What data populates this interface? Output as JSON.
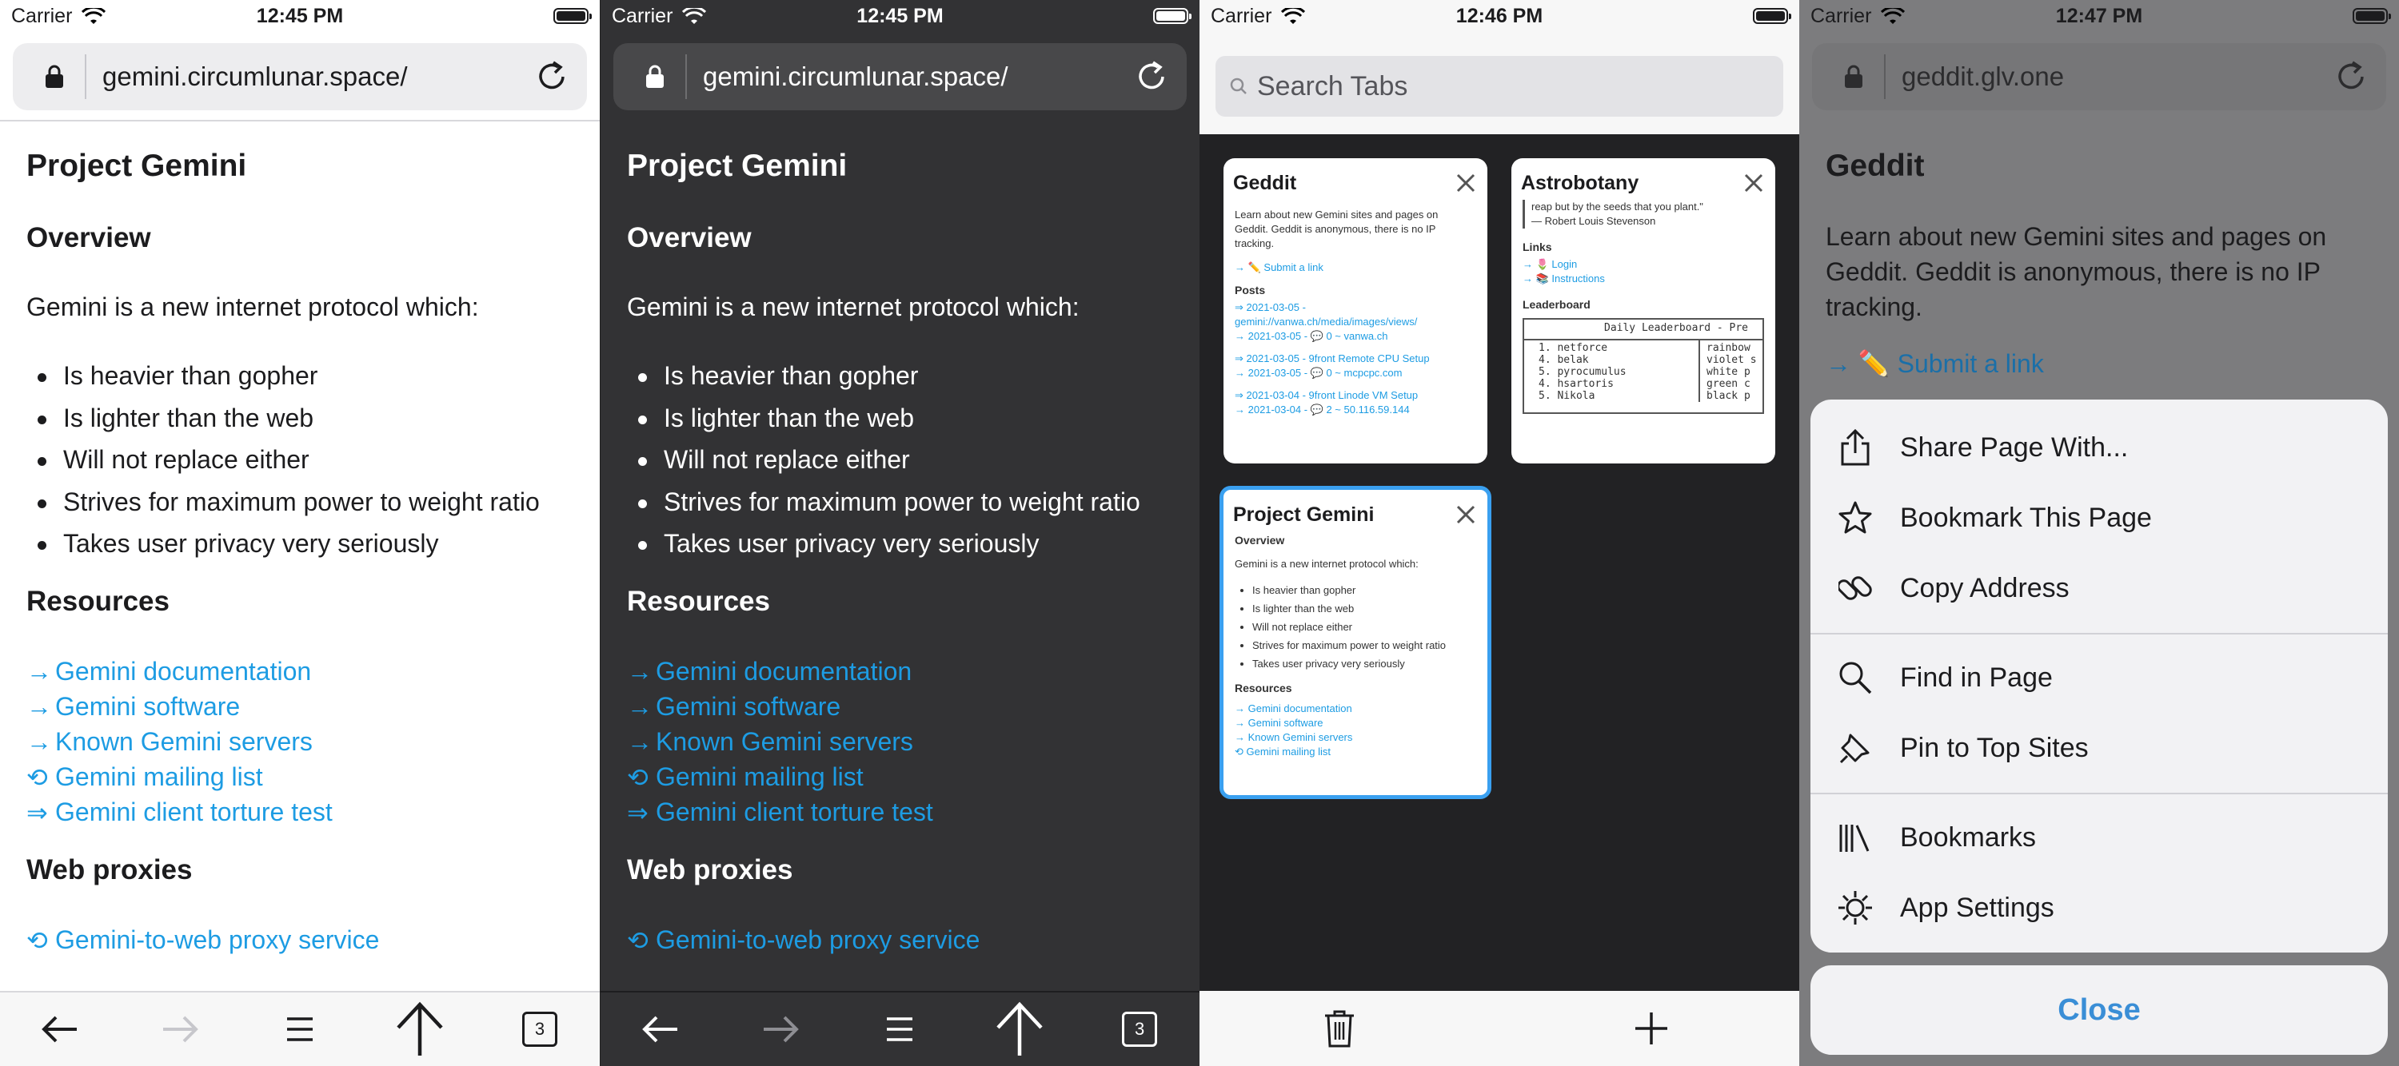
{
  "colors": {
    "link": "#1d9ce3",
    "accent": "#3aa0f0"
  },
  "screens": [
    {
      "status": {
        "carrier": "Carrier",
        "time": "12:45 PM"
      },
      "url": "gemini.circumlunar.space/"
    },
    {
      "status": {
        "carrier": "Carrier",
        "time": "12:45 PM"
      },
      "url": "gemini.circumlunar.space/"
    },
    {
      "status": {
        "carrier": "Carrier",
        "time": "12:46 PM"
      }
    },
    {
      "status": {
        "carrier": "Carrier",
        "time": "12:47 PM"
      },
      "url": "geddit.glv.one"
    }
  ],
  "page": {
    "title": "Project Gemini",
    "overview_heading": "Overview",
    "intro": "Gemini is a new internet protocol which:",
    "bullets": [
      "Is heavier than gopher",
      "Is lighter than the web",
      "Will not replace either",
      "Strives for maximum power to weight ratio",
      "Takes user privacy very seriously"
    ],
    "resources_heading": "Resources",
    "resources": [
      {
        "glyph": "→",
        "label": "Gemini documentation"
      },
      {
        "glyph": "→",
        "label": "Gemini software"
      },
      {
        "glyph": "→",
        "label": "Known Gemini servers"
      },
      {
        "glyph": "⟲",
        "label": "Gemini mailing list"
      },
      {
        "glyph": "⇒",
        "label": "Gemini client torture test"
      }
    ],
    "proxies_heading": "Web proxies",
    "proxies": [
      {
        "glyph": "⟲",
        "label": "Gemini-to-web proxy service"
      }
    ]
  },
  "toolbar": {
    "tab_count": "3"
  },
  "tabs": {
    "search_placeholder": "Search Tabs",
    "cards": [
      {
        "title": "Geddit",
        "lines": [
          "Learn about new Gemini sites and pages on",
          "Geddit. Geddit is anonymous, there is no IP",
          "tracking."
        ],
        "submit": "→ ✏️ Submit a link",
        "posts_heading": "Posts",
        "posts": [
          "⇒ 2021-03-05 -",
          "gemini://vanwa.ch/media/images/views/",
          "→ 2021-03-05 - 💬 0 ~ vanwa.ch",
          "⇒ 2021-03-05 - 9front Remote CPU Setup",
          "→ 2021-03-05 - 💬 0 ~ mcpcpc.com",
          "⇒ 2021-03-04 - 9front Linode VM Setup",
          "→ 2021-03-04 - 💬 2 ~ 50.116.59.144"
        ]
      },
      {
        "title": "Astrobotany",
        "quote": [
          "reap but by the seeds that you plant.\"",
          "— Robert Louis Stevenson"
        ],
        "links_heading": "Links",
        "links": [
          "→ 🌷 Login",
          "→ 📚 Instructions"
        ],
        "leaderboard_heading": "Leaderboard",
        "board_title": "Daily Leaderboard - Pre",
        "board_names": [
          "1. netforce",
          "4. belak",
          "5. pyrocumulus",
          "4. hsartoris",
          "5. Nikola"
        ],
        "board_values": [
          "rainbow",
          "violet s",
          "white p",
          "green c",
          "black p"
        ]
      },
      {
        "title": "Project Gemini",
        "heading": "Overview",
        "intro": "Gemini is a new internet protocol which:",
        "bullets": [
          "Is heavier than gopher",
          "Is lighter than the web",
          "Will not replace either",
          "Strives for maximum power to weight ratio",
          "Takes user privacy very seriously"
        ],
        "resources_heading": "Resources",
        "resources": [
          "→ Gemini documentation",
          "→ Gemini software",
          "→ Known Gemini servers",
          "⟲ Gemini mailing list"
        ]
      }
    ]
  },
  "geddit_page": {
    "title": "Geddit",
    "description": "Learn about new Gemini sites and pages on Geddit. Geddit is anonymous, there is no IP tracking.",
    "submit_link": "→ ✏️ Submit a link"
  },
  "action_sheet": {
    "items": [
      {
        "label": "Share Page With...",
        "icon": "share-icon"
      },
      {
        "label": "Bookmark This Page",
        "icon": "star-icon"
      },
      {
        "label": "Copy Address",
        "icon": "link-icon"
      },
      {
        "label": "Find in Page",
        "icon": "search-icon"
      },
      {
        "label": "Pin to Top Sites",
        "icon": "pin-icon"
      },
      {
        "label": "Bookmarks",
        "icon": "bookmarks-icon"
      },
      {
        "label": "App Settings",
        "icon": "gear-icon"
      }
    ],
    "close_label": "Close"
  }
}
